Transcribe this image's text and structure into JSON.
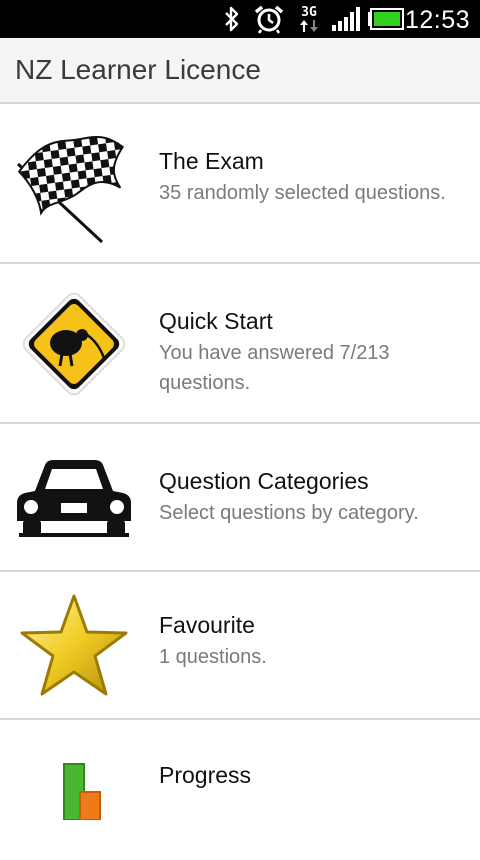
{
  "status_bar": {
    "time": "12:53",
    "icons": [
      "bluetooth-icon",
      "alarm-icon",
      "3g-data-icon",
      "signal-icon",
      "battery-icon"
    ],
    "network_label": "3G",
    "battery_color": "#2fd020"
  },
  "app": {
    "title": "NZ Learner Licence"
  },
  "menu": {
    "items": [
      {
        "title": "The Exam",
        "subtitle": "35 randomly selected questions.",
        "icon": "checkered-flag-icon"
      },
      {
        "title": "Quick Start",
        "subtitle": "You have answered 7/213 questions.",
        "icon": "kiwi-sign-icon"
      },
      {
        "title": "Question Categories",
        "subtitle": "Select questions by category.",
        "icon": "car-icon"
      },
      {
        "title": "Favourite",
        "subtitle": "1 questions.",
        "icon": "star-icon"
      },
      {
        "title": "Progress",
        "subtitle": "",
        "icon": "progress-chart-icon"
      }
    ]
  },
  "colors": {
    "status_bar_bg": "#000000",
    "action_bar_bg": "#f5f5f5",
    "divider": "#d6d6d6",
    "sign_yellow": "#f6c21a",
    "star_gold": "#e8c21c"
  }
}
